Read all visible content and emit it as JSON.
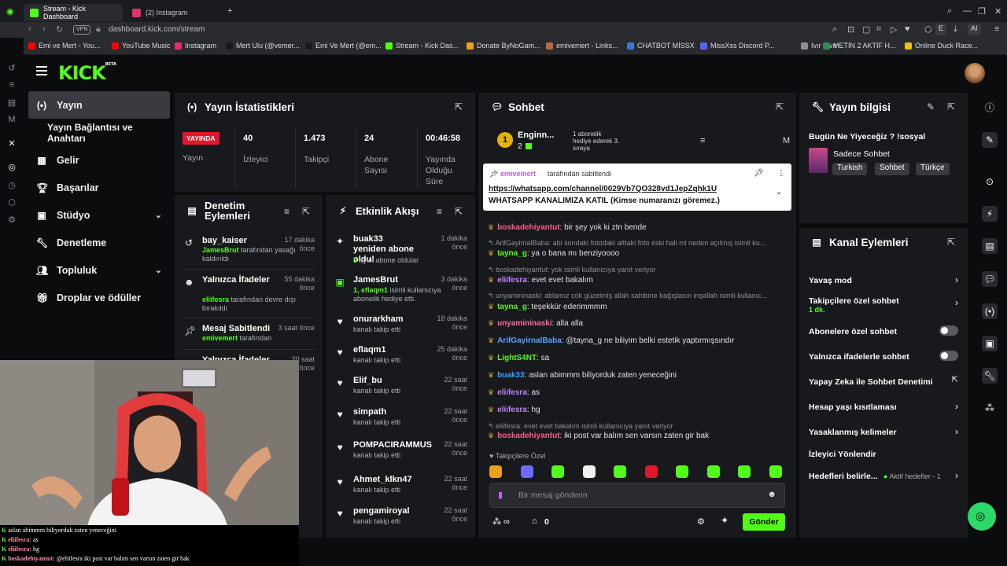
{
  "browser": {
    "tabs": [
      {
        "label": "Stream - Kick Dashboard",
        "color": "#53fc18"
      },
      {
        "label": "(2) Instagram",
        "color": "#e1306c"
      }
    ],
    "vpn": "VPN",
    "url": "dashboard.kick.com/stream",
    "ai_label": "AI",
    "bookmarks": [
      {
        "label": "Emi ve Mert - You...",
        "color": "#ff0000"
      },
      {
        "label": "YouTube Music",
        "color": "#ff0000"
      },
      {
        "label": "Instagram",
        "color": "#e1306c"
      },
      {
        "label": "Mert Ulu (@vemer...",
        "color": "#1a1a1a"
      },
      {
        "label": "Emi Ve Mert (@em...",
        "color": "#1a1a1a"
      },
      {
        "label": "Stream - Kick Das...",
        "color": "#53fc18"
      },
      {
        "label": "Donate ByNoGam...",
        "color": "#f0a020"
      },
      {
        "label": "emivemert - Links...",
        "color": "#b86a3a"
      },
      {
        "label": "CHATBOT MİSSX",
        "color": "#3a7bd5"
      },
      {
        "label": "MissXss Discord P...",
        "color": "#5865f2"
      },
      {
        "label": "Ivır Zıvır",
        "color": "#8f9095"
      },
      {
        "label": "METİN 2 AKTİF H...",
        "color": "#2e8b57"
      },
      {
        "label": "Online Duck Race...",
        "color": "#e8c020"
      }
    ]
  },
  "nav": {
    "items": [
      {
        "label": "Yayın",
        "icon": "broadcast-icon"
      },
      {
        "label": "Yayın Bağlantısı ve Anahtarı",
        "icon": ""
      },
      {
        "label": "Gelir",
        "icon": "revenue-icon"
      },
      {
        "label": "Başarılar",
        "icon": "trophy-icon"
      },
      {
        "label": "Stüdyo",
        "icon": "studio-icon"
      },
      {
        "label": "Denetleme",
        "icon": "wrench-icon"
      },
      {
        "label": "Topluluk",
        "icon": "community-icon"
      },
      {
        "label": "Droplar ve ödüller",
        "icon": "gift-icon"
      }
    ]
  },
  "stats": {
    "title": "Yayın İstatistikleri",
    "live": "YAYINDA",
    "live_label": "Yayın",
    "viewers": "40",
    "viewers_label": "İzleyici",
    "followers": "1.473",
    "followers_label": "Takipçi",
    "subs": "24",
    "subs_label": "Abone Sayısı",
    "duration": "00:46:58",
    "duration_label": "Yayında Olduğu Süre"
  },
  "moderation": {
    "title": "Denetim Eylemleri",
    "items": [
      {
        "title": "bay_kaiser",
        "time": "17 dakika önce",
        "user": "JamesBrut",
        "desc": "tarafından yasağı kaldırıldı"
      },
      {
        "title": "Yalnızca İfadeler",
        "time": "55 dakika önce",
        "user": "eliifesra",
        "desc": "tarafından devre dışı bırakıldı"
      },
      {
        "title": "Mesaj Sabitlendi",
        "time": "3 saat önce",
        "user": "emivemert",
        "desc": "tarafından"
      },
      {
        "title": "Yalnızca İfadeler",
        "time": "20 saat önce"
      }
    ]
  },
  "activity": {
    "title": "Etkinlik Akışı",
    "items": [
      {
        "title": "buak33 yeniden abone oldu!",
        "time": "1 dakika önce",
        "hl": "5",
        "desc": "aylık abone oldular"
      },
      {
        "title": "JamesBrut",
        "time": "3 dakika önce",
        "hl": "1, eflaqm1",
        "desc": "isimli kullanıcıya abonelik hediye etti."
      },
      {
        "title": "onurarkham",
        "time": "18 dakika önce",
        "desc": "kanalı takip etti"
      },
      {
        "title": "eflaqm1",
        "time": "25 dakika önce",
        "desc": "kanalı takip etti"
      },
      {
        "title": "Elif_bu",
        "time": "22 saat önce",
        "desc": "kanalı takip etti"
      },
      {
        "title": "simpath",
        "time": "22 saat önce",
        "desc": "kanalı takip etti"
      },
      {
        "title": "POMPACIRAMMUS",
        "time": "22 saat önce",
        "desc": "kanalı takip etti"
      },
      {
        "title": "Ahmet_klkn47",
        "time": "22 saat önce",
        "desc": "kanalı takip etti"
      },
      {
        "title": "pengamiroyal",
        "time": "22 saat önce",
        "desc": "kanalı takip etti"
      }
    ]
  },
  "chat": {
    "title": "Sohbet",
    "top": {
      "rank": "1",
      "name": "Enginn...",
      "count": "2",
      "gift_text": "1 abonelik hediye ederek 3. sıraya",
      "mode": "M"
    },
    "pinned": {
      "by_user": "emivemert",
      "by_text": "tarafından sabitlendi",
      "link": "https://whatsapp.com/channel/0029Vb7QO328vd1JepZqhk1U",
      "text": "WHATSAPP KANALIMIZA KATIL (Kimse numaranızı göremez.)"
    },
    "messages": [
      {
        "type": "msg",
        "user": "boskadehiyantut",
        "color": "#ff5a8a",
        "text": ": bir şey yok ki ztn bende"
      },
      {
        "type": "reply",
        "text": "ArifGayirnalBaba: abi sondaki fotodaki alttaki foto eski hali mi neden açılmış isimli ku..."
      },
      {
        "type": "msg",
        "user": "tayna_g",
        "color": "#53fc18",
        "text": ": ya o bana mı benziyoooo"
      },
      {
        "type": "reply",
        "text": "boskadehiyantut: yok isimli kullanıcıya yanıt veriyor"
      },
      {
        "type": "msg",
        "user": "eliifesra",
        "color": "#c080ff",
        "text": ": evet evet bakalım"
      },
      {
        "type": "reply",
        "text": "unyamininaski: ablamız cok güzelmiş allah sahibine bağışlasın inşallah isimli kullanıc..."
      },
      {
        "type": "msg",
        "user": "tayna_g",
        "color": "#53fc18",
        "text": ": teşekkür ederimmmm"
      },
      {
        "type": "msg",
        "user": "unyamininaski",
        "color": "#ff6aa0",
        "text": ": alla alla"
      },
      {
        "type": "msg",
        "user": "ArifGayirnalBaba",
        "color": "#5aa0ff",
        "text": ": @tayna_g ne biliyim belki estetik yaptırmışsındır"
      },
      {
        "type": "msg",
        "user": "LightS4NT",
        "color": "#53fc18",
        "text": ": sa"
      },
      {
        "type": "msg",
        "user": "buak33",
        "color": "#3aa0ff",
        "text": ": aslan abimmm biliyorduk zaten yeneceğini"
      },
      {
        "type": "msg",
        "user": "eliifesra",
        "color": "#c080ff",
        "text": ": as"
      },
      {
        "type": "msg",
        "user": "eliifesra",
        "color": "#c080ff",
        "text": ": hg"
      },
      {
        "type": "reply",
        "text": "eliifesra: evet evet bakalım isimli kullanıcıya yanıt veriyor"
      },
      {
        "type": "msg",
        "user": "boskadehiyantut",
        "color": "#ff5a8a",
        "text": ": iki post var balım sen varsın zaten gir bak"
      }
    ],
    "followers_only": "Takipçilere Özel",
    "input_placeholder": "Bir mesaj gönderin",
    "count": "0",
    "send": "Gönder"
  },
  "stream_info": {
    "title": "Yayın bilgisi",
    "stream_title": "Bugün Ne Yiyeceğiz ? !sosyal",
    "category": "Sadece Sohbet",
    "tags": [
      "Turkish",
      "Sohbet",
      "Türkçe"
    ]
  },
  "channel_actions": {
    "title": "Kanal Eylemleri",
    "items": [
      {
        "label": "Yavaş mod",
        "control": "chevron"
      },
      {
        "label": "Takipçilere özel sohbet",
        "sub": "1 dk.",
        "control": "chevron"
      },
      {
        "label": "Abonelere özel sohbet",
        "control": "toggle"
      },
      {
        "label": "Yalnızca ifadelerle sohbet",
        "control": "toggle"
      },
      {
        "label": "Yapay Zeka ile Sohbet Denetimi",
        "control": "external"
      },
      {
        "label": "Hesap yaşı kısıtlaması",
        "control": "chevron"
      },
      {
        "label": "Yasaklanmış kelimeler",
        "control": "chevron"
      },
      {
        "label": "İzleyici Yönlendir",
        "control": "none"
      },
      {
        "label": "Hedefleri belirle...",
        "sub": "Aktif hedefler - 1",
        "control": "chevron"
      }
    ]
  },
  "webcam_chat": [
    {
      "user": "",
      "text": "aslan abimmm biliyorduk zaten yeneceğini"
    },
    {
      "user": "eliifesra:",
      "text": "as"
    },
    {
      "user": "eliifesra:",
      "text": "hg"
    },
    {
      "user": "boskadehiyantut:",
      "text": "@eliifesra iki post var balım sen varsın zaten gir bak"
    }
  ],
  "colors": {
    "brand": "#53fc18",
    "live": "#e3162b",
    "panel": "#18191c",
    "bg": "#0b0c0e"
  }
}
